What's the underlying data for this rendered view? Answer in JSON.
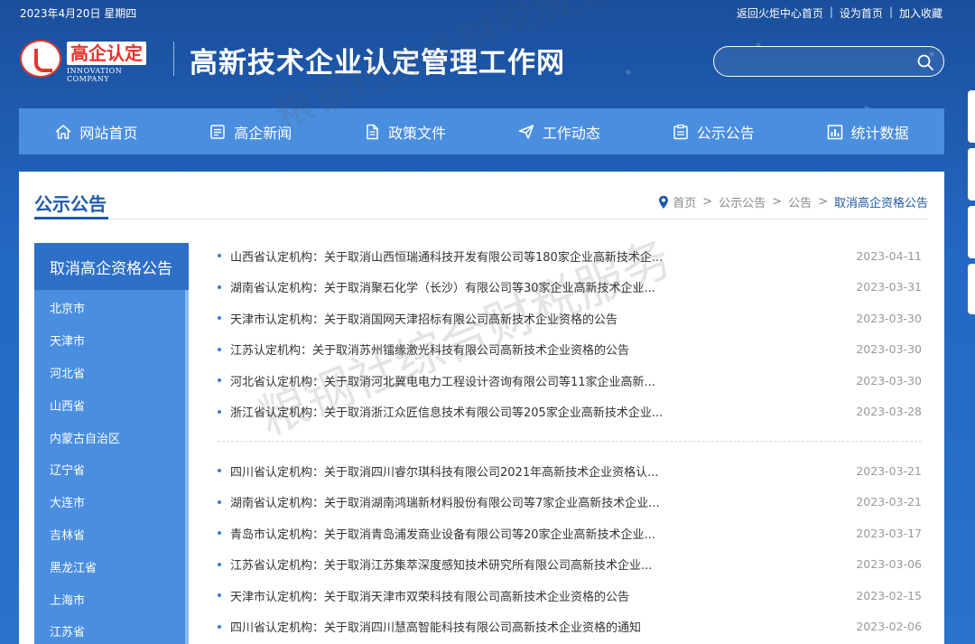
{
  "topbar": {
    "date": "2023年4月20日 星期四",
    "links": [
      "返回火炬中心首页",
      "设为首页",
      "加入收藏"
    ],
    "separator": "|"
  },
  "logo": {
    "cn": "高企认定",
    "en": "INNOVATION COMPANY"
  },
  "site_title": "高新技术企业认定管理工作网",
  "search": {
    "placeholder": "",
    "icon": "search-icon"
  },
  "nav": [
    {
      "label": "网站首页",
      "icon": "home-icon"
    },
    {
      "label": "高企新闻",
      "icon": "news-icon"
    },
    {
      "label": "政策文件",
      "icon": "document-icon"
    },
    {
      "label": "工作动态",
      "icon": "send-icon"
    },
    {
      "label": "公示公告",
      "icon": "clipboard-icon"
    },
    {
      "label": "统计数据",
      "icon": "chart-icon"
    }
  ],
  "panel": {
    "title": "公示公告",
    "breadcrumb": [
      "首页",
      "公示公告",
      "公告",
      "取消高企资格公告"
    ],
    "breadcrumb_sep": ">"
  },
  "sidebar": {
    "heading": "取消高企资格公告",
    "items": [
      "北京市",
      "天津市",
      "河北省",
      "山西省",
      "内蒙古自治区",
      "辽宁省",
      "大连市",
      "吉林省",
      "黑龙江省",
      "上海市",
      "江苏省"
    ]
  },
  "news_group1": [
    {
      "title": "山西省认定机构：关于取消山西恒瑞通科技开发有限公司等180家企业高新技术企...",
      "date": "2023-04-11"
    },
    {
      "title": "湖南省认定机构：关于取消聚石化学（长沙）有限公司等30家企业高新技术企业...",
      "date": "2023-03-31"
    },
    {
      "title": "天津市认定机构：关于取消国网天津招标有限公司高新技术企业资格的公告",
      "date": "2023-03-30"
    },
    {
      "title": "江苏认定机构：关于取消苏州镭缘激光科技有限公司高新技术企业资格的公告",
      "date": "2023-03-30"
    },
    {
      "title": "河北省认定机构：关于取消河北冀电电力工程设计咨询有限公司等11家企业高新...",
      "date": "2023-03-30"
    },
    {
      "title": "浙江省认定机构：关于取消浙江众匠信息技术有限公司等205家企业高新技术企业...",
      "date": "2023-03-28"
    }
  ],
  "news_group2": [
    {
      "title": "四川省认定机构：关于取消四川睿尔琪科技有限公司2021年高新技术企业资格认...",
      "date": "2023-03-21"
    },
    {
      "title": "湖南省认定机构：关于取消湖南鸿瑞新材料股份有限公司等7家企业高新技术企业...",
      "date": "2023-03-21"
    },
    {
      "title": "青岛市认定机构：关于取消青岛浦发商业设备有限公司等20家企业高新技术企业...",
      "date": "2023-03-17"
    },
    {
      "title": "江苏省认定机构：关于取消江苏集萃深度感知技术研究所有限公司高新技术企业...",
      "date": "2023-03-06"
    },
    {
      "title": "天津市认定机构：关于取消天津市双荣科技有限公司高新技术企业资格的公告",
      "date": "2023-02-15"
    },
    {
      "title": "四川省认定机构：关于取消四川慧高智能科技有限公司高新技术企业资格的通知",
      "date": "2023-02-06"
    }
  ],
  "watermark": "粮钢社综合财税服务",
  "colors": {
    "header_blue": "#2368c3",
    "nav_blue": "#4a8ee0",
    "sidebar_head": "#2e6fc7",
    "accent": "#1e5aa8"
  }
}
